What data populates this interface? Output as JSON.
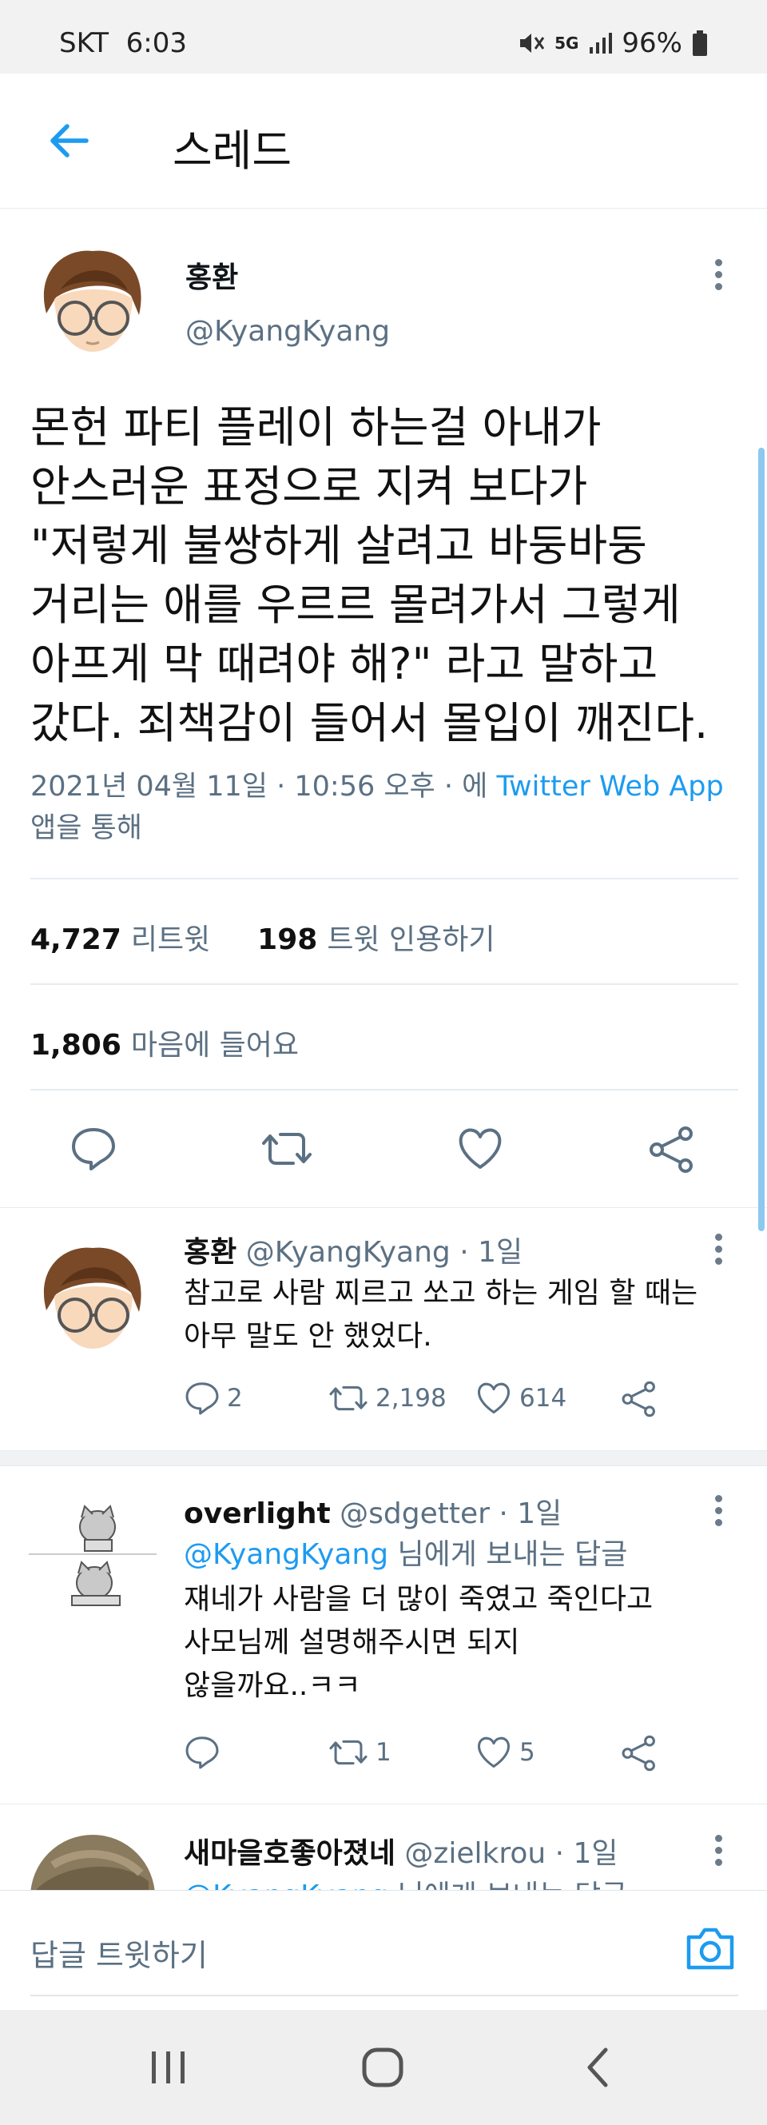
{
  "status": {
    "carrier": "SKT",
    "time": "6:03",
    "network": "5G",
    "battery": "96%"
  },
  "header": {
    "title": "스레드"
  },
  "tweet": {
    "author": "홍환",
    "handle": "@KyangKyang",
    "lines": [
      "몬헌 파티 플레이 하는걸 아내가",
      "안스러운 표정으로 지켜 보다가",
      "\"저렇게 불쌍하게 살려고 바둥바둥",
      "거리는 애를 우르르 몰려가서 그렇게",
      "아프게 막 때려야 해?\" 라고 말하고",
      "갔다. 죄책감이 들어서 몰입이 깨진다."
    ],
    "meta_line1": "2021년 04월 11일 · 10:56 오후 · 에 ",
    "meta_link": "Twitter Web App",
    "meta_line2": "앱을 통해",
    "retweets": "4,727",
    "retweets_label": "리트윗",
    "quotes": "198",
    "quotes_label": "트윗 인용하기",
    "likes": "1,806",
    "likes_label": "마음에 들어요"
  },
  "replies": [
    {
      "author": "홍환",
      "handle": "@KyangKyang",
      "time": "· 1일",
      "mention_to": "",
      "mention_suffix": "",
      "lines": [
        "참고로 사람 찌르고 쏘고 하는 게임 할 때는",
        "아무 말도 안 했었다."
      ],
      "replies": "2",
      "retweets": "2,198",
      "likes": "614"
    },
    {
      "author": "overlight",
      "handle": "@sdgetter",
      "time": "· 1일",
      "mention_to": "@KyangKyang",
      "mention_suffix": " 님에게 보내는 답글",
      "lines": [
        "쟤네가 사람을 더 많이 죽였고 죽인다고",
        "사모님께 설명해주시면 되지",
        "않을까요..ㅋㅋ"
      ],
      "replies": "",
      "retweets": "1",
      "likes": "5"
    },
    {
      "author": "새마을호좋아졌네",
      "handle": "@zielkrou",
      "time": "· 1일",
      "mention_to": "@KyangKyang",
      "mention_suffix": " 님에게 보내는 답글"
    }
  ],
  "composer": {
    "placeholder": "답글 트윗하기"
  },
  "colors": {
    "accent": "#1d9bf0",
    "secondary_text": "#5b7083"
  }
}
